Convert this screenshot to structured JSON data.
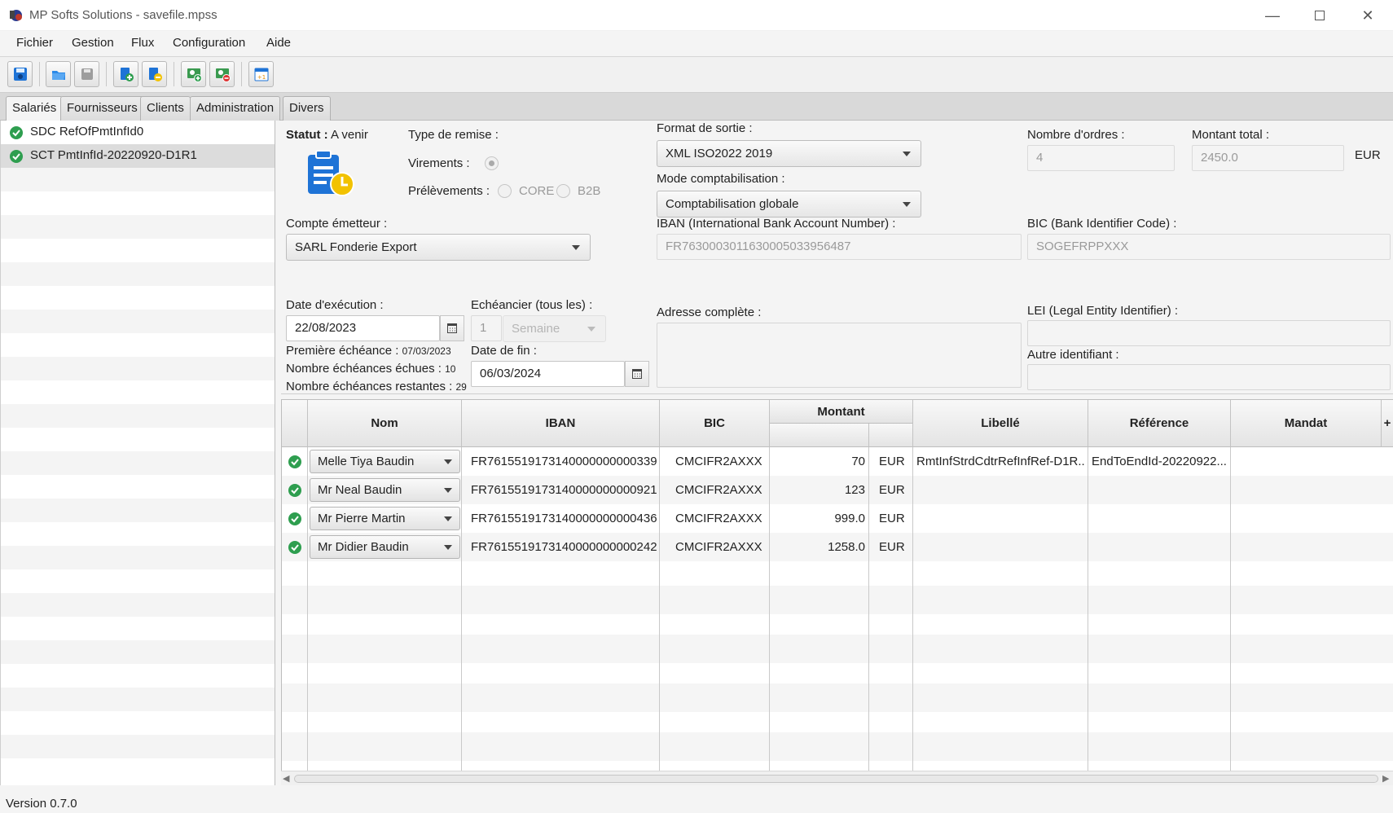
{
  "window": {
    "title": "MP Softs Solutions - savefile.mpss"
  },
  "menu": [
    "Fichier",
    "Gestion",
    "Flux",
    "Configuration",
    "Aide"
  ],
  "toolbar": {
    "buttons": [
      "save-disk",
      "open-folder",
      "save-gray",
      "add-file",
      "remove-file",
      "add-person",
      "remove-person",
      "calendar"
    ]
  },
  "tabs": [
    "Salariés",
    "Fournisseurs",
    "Clients",
    "Administration",
    "Divers"
  ],
  "left_list": [
    {
      "label": "SDC RefOfPmtInfId0",
      "status": "valid"
    },
    {
      "label": "SCT PmtInfId-20220920-D1R1",
      "status": "valid",
      "selected": true
    }
  ],
  "form": {
    "statut_label": "Statut :",
    "statut_value": "A venir",
    "type_remise_label": "Type de remise :",
    "virements_label": "Virements :",
    "prelevements_label": "Prélèvements :",
    "core_label": "CORE",
    "b2b_label": "B2B",
    "format_label": "Format de sortie :",
    "format_value": "XML ISO2022 2019",
    "mode_label": "Mode comptabilisation :",
    "mode_value": "Comptabilisation globale",
    "nb_ordres_label": "Nombre d'ordres :",
    "nb_ordres_value": "4",
    "montant_total_label": "Montant total :",
    "montant_total_value": "2450.0",
    "montant_total_currency": "EUR",
    "compte_label": "Compte émetteur :",
    "compte_value": "SARL Fonderie Export",
    "iban_label": "IBAN (International Bank Account Number) :",
    "iban_value": "FR7630003011630005033956487",
    "bic_label": "BIC (Bank Identifier Code) :",
    "bic_value": "SOGEFRPPXXX",
    "date_exec_label": "Date d'exécution :",
    "date_exec_value": "22/08/2023",
    "echeancier_label": "Echéancier (tous les) :",
    "echeancier_count": "1",
    "echeancier_unit": "Semaine",
    "adresse_label": "Adresse complète :",
    "lei_label": "LEI (Legal Entity Identifier) :",
    "premiere_label": "Première échéance :",
    "premiere_value": "07/03/2023",
    "echues_label": "Nombre échéances échues :",
    "echues_value": "10",
    "restantes_label": "Nombre échéances restantes :",
    "restantes_value": "29",
    "date_fin_label": "Date de fin :",
    "date_fin_value": "06/03/2024",
    "autre_label": "Autre identifiant :"
  },
  "table": {
    "headers": {
      "nom": "Nom",
      "iban": "IBAN",
      "bic": "BIC",
      "montant": "Montant",
      "libelle": "Libellé",
      "reference": "Référence",
      "mandat": "Mandat",
      "add": "+"
    },
    "rows": [
      {
        "nom": "Melle Tiya Baudin",
        "iban": "FR7615519173140000000000339",
        "bic": "CMCIFR2AXXX",
        "montant": "70",
        "devise": "EUR",
        "libelle": "RmtInfStrdCdtrRefInfRef-D1R...",
        "reference": "EndToEndId-20220922...",
        "mandat": ""
      },
      {
        "nom": "Mr Neal Baudin",
        "iban": "FR7615519173140000000000921",
        "bic": "CMCIFR2AXXX",
        "montant": "123",
        "devise": "EUR",
        "libelle": "",
        "reference": "",
        "mandat": ""
      },
      {
        "nom": "Mr Pierre Martin",
        "iban": "FR7615519173140000000000436",
        "bic": "CMCIFR2AXXX",
        "montant": "999.0",
        "devise": "EUR",
        "libelle": "",
        "reference": "",
        "mandat": ""
      },
      {
        "nom": "Mr Didier Baudin",
        "iban": "FR7615519173140000000000242",
        "bic": "CMCIFR2AXXX",
        "montant": "1258.0",
        "devise": "EUR",
        "libelle": "",
        "reference": "",
        "mandat": ""
      }
    ]
  },
  "status": {
    "version": "Version 0.7.0"
  },
  "colors": {
    "check_green": "#2e9e4f",
    "doc_blue": "#1e73d6",
    "clock_yellow": "#f2c200"
  }
}
